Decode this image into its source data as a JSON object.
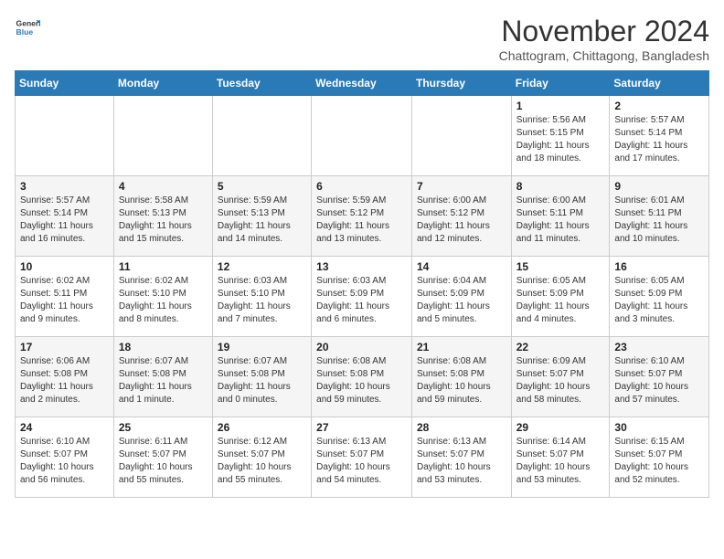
{
  "header": {
    "logo": {
      "general": "General",
      "blue": "Blue"
    },
    "title": "November 2024",
    "subtitle": "Chattogram, Chittagong, Bangladesh"
  },
  "weekdays": [
    "Sunday",
    "Monday",
    "Tuesday",
    "Wednesday",
    "Thursday",
    "Friday",
    "Saturday"
  ],
  "weeks": [
    [
      {
        "day": "",
        "info": ""
      },
      {
        "day": "",
        "info": ""
      },
      {
        "day": "",
        "info": ""
      },
      {
        "day": "",
        "info": ""
      },
      {
        "day": "",
        "info": ""
      },
      {
        "day": "1",
        "info": "Sunrise: 5:56 AM\nSunset: 5:15 PM\nDaylight: 11 hours\nand 18 minutes."
      },
      {
        "day": "2",
        "info": "Sunrise: 5:57 AM\nSunset: 5:14 PM\nDaylight: 11 hours\nand 17 minutes."
      }
    ],
    [
      {
        "day": "3",
        "info": "Sunrise: 5:57 AM\nSunset: 5:14 PM\nDaylight: 11 hours\nand 16 minutes."
      },
      {
        "day": "4",
        "info": "Sunrise: 5:58 AM\nSunset: 5:13 PM\nDaylight: 11 hours\nand 15 minutes."
      },
      {
        "day": "5",
        "info": "Sunrise: 5:59 AM\nSunset: 5:13 PM\nDaylight: 11 hours\nand 14 minutes."
      },
      {
        "day": "6",
        "info": "Sunrise: 5:59 AM\nSunset: 5:12 PM\nDaylight: 11 hours\nand 13 minutes."
      },
      {
        "day": "7",
        "info": "Sunrise: 6:00 AM\nSunset: 5:12 PM\nDaylight: 11 hours\nand 12 minutes."
      },
      {
        "day": "8",
        "info": "Sunrise: 6:00 AM\nSunset: 5:11 PM\nDaylight: 11 hours\nand 11 minutes."
      },
      {
        "day": "9",
        "info": "Sunrise: 6:01 AM\nSunset: 5:11 PM\nDaylight: 11 hours\nand 10 minutes."
      }
    ],
    [
      {
        "day": "10",
        "info": "Sunrise: 6:02 AM\nSunset: 5:11 PM\nDaylight: 11 hours\nand 9 minutes."
      },
      {
        "day": "11",
        "info": "Sunrise: 6:02 AM\nSunset: 5:10 PM\nDaylight: 11 hours\nand 8 minutes."
      },
      {
        "day": "12",
        "info": "Sunrise: 6:03 AM\nSunset: 5:10 PM\nDaylight: 11 hours\nand 7 minutes."
      },
      {
        "day": "13",
        "info": "Sunrise: 6:03 AM\nSunset: 5:09 PM\nDaylight: 11 hours\nand 6 minutes."
      },
      {
        "day": "14",
        "info": "Sunrise: 6:04 AM\nSunset: 5:09 PM\nDaylight: 11 hours\nand 5 minutes."
      },
      {
        "day": "15",
        "info": "Sunrise: 6:05 AM\nSunset: 5:09 PM\nDaylight: 11 hours\nand 4 minutes."
      },
      {
        "day": "16",
        "info": "Sunrise: 6:05 AM\nSunset: 5:09 PM\nDaylight: 11 hours\nand 3 minutes."
      }
    ],
    [
      {
        "day": "17",
        "info": "Sunrise: 6:06 AM\nSunset: 5:08 PM\nDaylight: 11 hours\nand 2 minutes."
      },
      {
        "day": "18",
        "info": "Sunrise: 6:07 AM\nSunset: 5:08 PM\nDaylight: 11 hours\nand 1 minute."
      },
      {
        "day": "19",
        "info": "Sunrise: 6:07 AM\nSunset: 5:08 PM\nDaylight: 11 hours\nand 0 minutes."
      },
      {
        "day": "20",
        "info": "Sunrise: 6:08 AM\nSunset: 5:08 PM\nDaylight: 10 hours\nand 59 minutes."
      },
      {
        "day": "21",
        "info": "Sunrise: 6:08 AM\nSunset: 5:08 PM\nDaylight: 10 hours\nand 59 minutes."
      },
      {
        "day": "22",
        "info": "Sunrise: 6:09 AM\nSunset: 5:07 PM\nDaylight: 10 hours\nand 58 minutes."
      },
      {
        "day": "23",
        "info": "Sunrise: 6:10 AM\nSunset: 5:07 PM\nDaylight: 10 hours\nand 57 minutes."
      }
    ],
    [
      {
        "day": "24",
        "info": "Sunrise: 6:10 AM\nSunset: 5:07 PM\nDaylight: 10 hours\nand 56 minutes."
      },
      {
        "day": "25",
        "info": "Sunrise: 6:11 AM\nSunset: 5:07 PM\nDaylight: 10 hours\nand 55 minutes."
      },
      {
        "day": "26",
        "info": "Sunrise: 6:12 AM\nSunset: 5:07 PM\nDaylight: 10 hours\nand 55 minutes."
      },
      {
        "day": "27",
        "info": "Sunrise: 6:13 AM\nSunset: 5:07 PM\nDaylight: 10 hours\nand 54 minutes."
      },
      {
        "day": "28",
        "info": "Sunrise: 6:13 AM\nSunset: 5:07 PM\nDaylight: 10 hours\nand 53 minutes."
      },
      {
        "day": "29",
        "info": "Sunrise: 6:14 AM\nSunset: 5:07 PM\nDaylight: 10 hours\nand 53 minutes."
      },
      {
        "day": "30",
        "info": "Sunrise: 6:15 AM\nSunset: 5:07 PM\nDaylight: 10 hours\nand 52 minutes."
      }
    ]
  ]
}
